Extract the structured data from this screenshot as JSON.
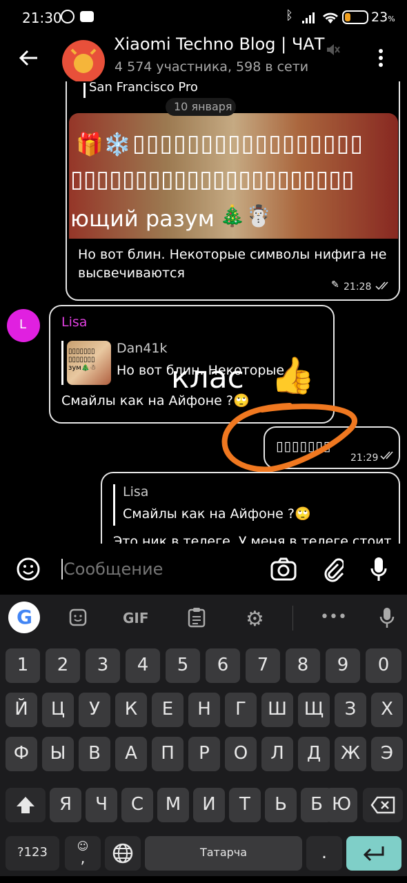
{
  "status_bar": {
    "time": "21:30",
    "battery": "23",
    "battery_suffix": "%"
  },
  "header": {
    "title": "Xiaomi Techno Blog | ЧАТ",
    "subtitle": "4 574 участника, 598 в сети"
  },
  "chat": {
    "date_label": "10 января",
    "top_reply_author": "San Francisco Pro",
    "msg1": {
      "image_text": "ющий разум",
      "text": "Но вот блин. Некоторые символы нифига не высвечиваются",
      "time": "21:28"
    },
    "msg2": {
      "sender_initial": "L",
      "sender": "Lisa",
      "reply_author": "Dan41k",
      "reply_text": "Но вот блин. Некоторые с...",
      "text": "Смайлы как на Айфоне ?🙄"
    },
    "overlay_text": "клас",
    "msg3": {
      "text": "▯▯▯▯▯▯▯",
      "time": "21:29"
    },
    "msg4": {
      "reply_author": "Lisa",
      "reply_text": "Смайлы как на Айфоне ?🙄",
      "text": "Это ник в телеге. У меня в телеге стоит"
    }
  },
  "composer": {
    "placeholder": "Сообщение"
  },
  "keyboard": {
    "toolbar": {
      "gif": "GIF"
    },
    "row_numbers": [
      "1",
      "2",
      "3",
      "4",
      "5",
      "6",
      "7",
      "8",
      "9",
      "0"
    ],
    "row1": [
      "Й",
      "Ц",
      "У",
      "К",
      "Е",
      "Н",
      "Г",
      "Ш",
      "Щ",
      "З",
      "Х"
    ],
    "row2": [
      "Ф",
      "Ы",
      "В",
      "А",
      "П",
      "Р",
      "О",
      "Л",
      "Д",
      "Ж",
      "Э"
    ],
    "row3": [
      "Я",
      "Ч",
      "С",
      "М",
      "И",
      "Т",
      "Ь",
      "Б",
      "Ю"
    ],
    "sym_key": "?123",
    "space_label": "Татарча",
    "period": ".",
    "comma": ","
  }
}
